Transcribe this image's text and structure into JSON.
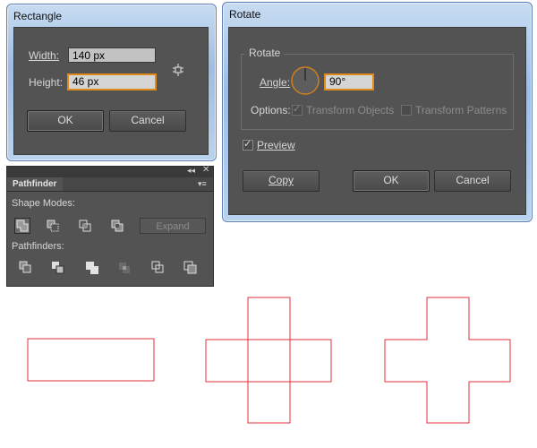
{
  "rectangle_dialog": {
    "title": "Rectangle",
    "width_label": "Width:",
    "width_value": "140 px",
    "height_label": "Height:",
    "height_value": "46 px",
    "ok_label": "OK",
    "cancel_label": "Cancel"
  },
  "rotate_dialog": {
    "title": "Rotate",
    "group_label": "Rotate",
    "angle_label": "Angle:",
    "angle_value": "90°",
    "options_label": "Options:",
    "transform_objects_label": "Transform Objects",
    "transform_patterns_label": "Transform Patterns",
    "preview_label": "Preview",
    "copy_label": "Copy",
    "ok_label": "OK",
    "cancel_label": "Cancel"
  },
  "pathfinder": {
    "tab_label": "Pathfinder",
    "shape_modes_label": "Shape Modes:",
    "pathfinders_label": "Pathfinders:",
    "expand_label": "Expand",
    "shape_mode_icons": [
      "unite-icon",
      "minus-front-icon",
      "intersect-icon",
      "exclude-icon"
    ],
    "pathfinder_icons": [
      "divide-icon",
      "trim-icon",
      "merge-icon",
      "crop-icon",
      "outline-icon",
      "minus-back-icon"
    ]
  },
  "colors": {
    "shape_stroke": "#e0323a",
    "focus_border": "#e08a1c",
    "dialog_body": "#535353"
  }
}
